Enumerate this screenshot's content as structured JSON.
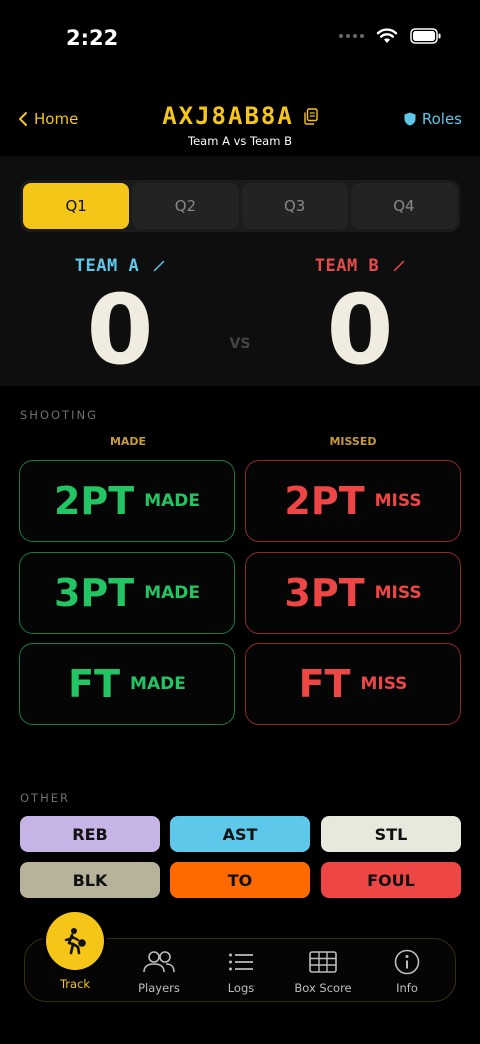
{
  "status_bar": {
    "time": "2:22"
  },
  "nav": {
    "back_label": "Home",
    "game_code": "AXJ8AB8A",
    "matchup": "Team A vs Team B",
    "roles_label": "Roles"
  },
  "quarters": [
    "Q1",
    "Q2",
    "Q3",
    "Q4"
  ],
  "active_quarter": "Q1",
  "teams": {
    "a": {
      "name": "TEAM A",
      "score": "0",
      "color": "#5ec8ea"
    },
    "b": {
      "name": "TEAM B",
      "score": "0",
      "color": "#e74a4a"
    }
  },
  "vs_label": "VS",
  "shooting": {
    "section_label": "SHOOTING",
    "made_header": "MADE",
    "missed_header": "MISSED",
    "made": [
      {
        "big": "2PT",
        "small": "MADE"
      },
      {
        "big": "3PT",
        "small": "MADE"
      },
      {
        "big": "FT",
        "small": "MADE"
      }
    ],
    "miss": [
      {
        "big": "2PT",
        "small": "MISS"
      },
      {
        "big": "3PT",
        "small": "MISS"
      },
      {
        "big": "FT",
        "small": "MISS"
      }
    ]
  },
  "other": {
    "section_label": "OTHER",
    "buttons": [
      {
        "label": "REB",
        "color": "#c6b4e6"
      },
      {
        "label": "AST",
        "color": "#5ec8ea"
      },
      {
        "label": "STL",
        "color": "#e9e8dc"
      },
      {
        "label": "BLK",
        "color": "#b7b29a"
      },
      {
        "label": "TO",
        "color": "#ff6a00"
      },
      {
        "label": "FOUL",
        "color": "#ee4545"
      }
    ]
  },
  "tabs": [
    {
      "label": "Track",
      "icon": "basketball-player-icon",
      "active": true
    },
    {
      "label": "Players",
      "icon": "people-icon"
    },
    {
      "label": "Logs",
      "icon": "list-icon"
    },
    {
      "label": "Box Score",
      "icon": "table-icon"
    },
    {
      "label": "Info",
      "icon": "info-icon"
    }
  ],
  "colors": {
    "accent": "#f5c518",
    "made": "#22c463",
    "miss": "#ee4545",
    "background": "#000000"
  }
}
